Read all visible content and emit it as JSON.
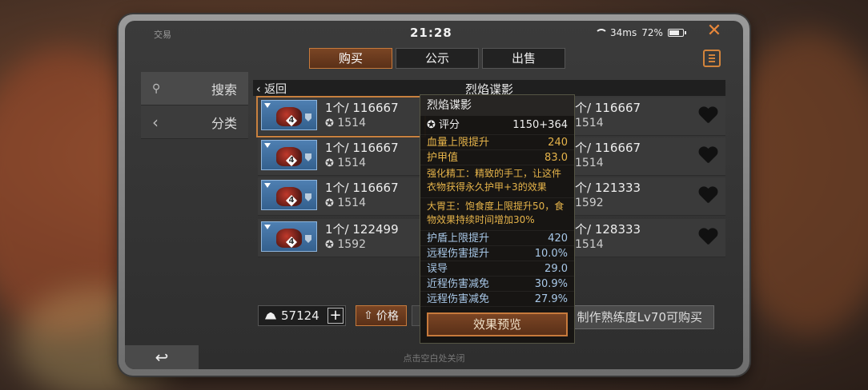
{
  "status_bar": {
    "title": "交易",
    "time": "21:28",
    "ping": "34ms",
    "battery": "72%"
  },
  "tabs": [
    {
      "label": "购买",
      "active": true
    },
    {
      "label": "公示",
      "active": false
    },
    {
      "label": "出售",
      "active": false
    }
  ],
  "sidebar": {
    "items": [
      {
        "label": "搜索",
        "icon": "search-icon"
      },
      {
        "label": "分类",
        "icon": "chevron-left-icon"
      }
    ]
  },
  "list_header": {
    "back_label": "返回",
    "title": "烈焰谍影"
  },
  "listings_left": [
    {
      "price": "1个/ 116667",
      "score": "1514",
      "level": "4"
    },
    {
      "price": "1个/ 116667",
      "score": "1514",
      "level": "4"
    },
    {
      "price": "1个/ 116667",
      "score": "1514",
      "level": "4"
    },
    {
      "price": "1个/ 122499",
      "score": "1592",
      "level": "4"
    }
  ],
  "listings_right": [
    {
      "price": "个/ 116667",
      "score": "1514"
    },
    {
      "price": "个/ 116667",
      "score": "1514"
    },
    {
      "price": "个/ 121333",
      "score": "1592"
    },
    {
      "price": "个/ 128333",
      "score": "1514"
    }
  ],
  "tooltip": {
    "title": "烈焰谍影",
    "score_label": "评分",
    "score_value": "1150+364",
    "stats_gold": [
      {
        "label": "血量上限提升",
        "value": "240"
      },
      {
        "label": "护甲值",
        "value": "83.0"
      }
    ],
    "desc1": "强化精工：精致的手工，让这件衣物获得永久护甲+3的效果",
    "desc2": "大胃王：饱食度上限提升50，食物效果持续时间增加30%",
    "stats_blue": [
      {
        "label": "护盾上限提升",
        "value": "420"
      },
      {
        "label": "远程伤害提升",
        "value": "10.0%"
      },
      {
        "label": "误导",
        "value": "29.0"
      },
      {
        "label": "近程伤害减免",
        "value": "30.9%"
      },
      {
        "label": "远程伤害减免",
        "value": "27.9%"
      }
    ],
    "button": "效果预览"
  },
  "bottom": {
    "money": "57124",
    "sort_label": "价格",
    "buy_requirement": "制作熟练度Lv70可购买",
    "hint": "点击空白处关闭"
  },
  "colors": {
    "accent": "#c77a3c",
    "gold_text": "#e6b44a",
    "blue_text": "#a8c8e8",
    "close": "#e8873a"
  }
}
